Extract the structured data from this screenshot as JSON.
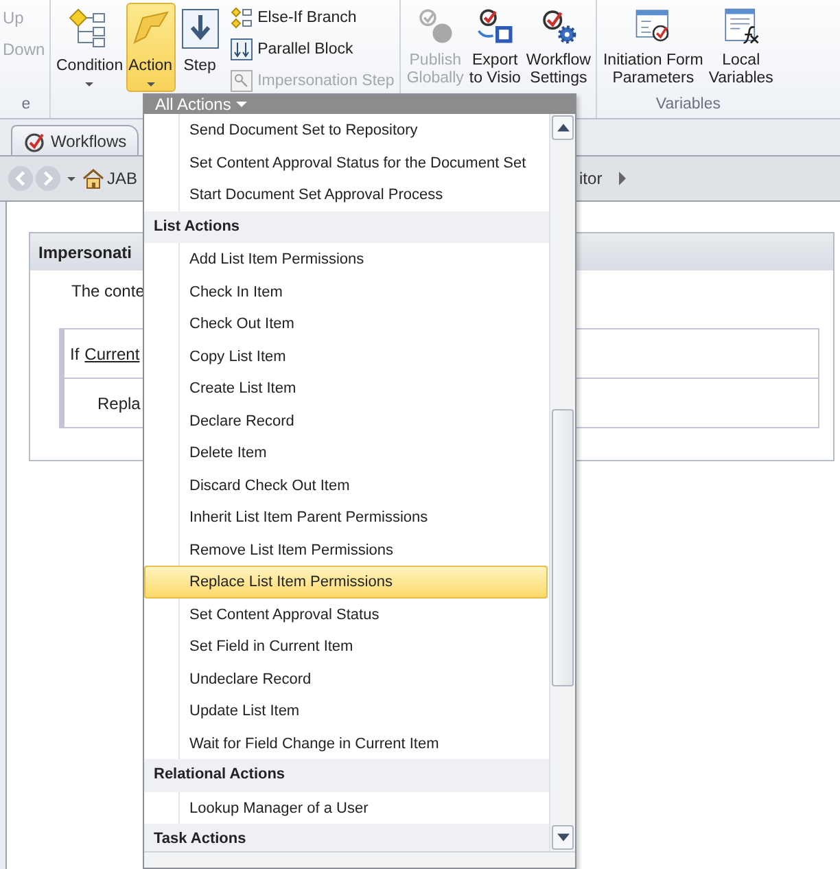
{
  "ribbon": {
    "clipped_group": {
      "buttons": [
        {
          "label": "Up",
          "disabled": true
        },
        {
          "label": "Down",
          "disabled": true
        }
      ],
      "group_label": "e"
    },
    "large_buttons": [
      {
        "label": "Condition",
        "dropdown": true,
        "selected": false
      },
      {
        "label": "Action",
        "dropdown": true,
        "selected": true
      },
      {
        "label": "Step",
        "dropdown": false,
        "selected": false
      }
    ],
    "small_buttons": [
      {
        "label": "Else-If Branch",
        "disabled": false
      },
      {
        "label": "Parallel Block",
        "disabled": false
      },
      {
        "label": "Impersonation Step",
        "disabled": true
      }
    ],
    "manage_buttons": [
      {
        "lines": [
          "Publish",
          "Globally"
        ],
        "disabled": true
      },
      {
        "lines": [
          "Export",
          "to Visio"
        ],
        "disabled": false
      },
      {
        "lines": [
          "Workflow",
          "Settings"
        ],
        "disabled": false
      }
    ],
    "variables_group": {
      "buttons": [
        {
          "lines": [
            "Initiation Form",
            "Parameters"
          ]
        },
        {
          "lines": [
            "Local",
            "Variables"
          ]
        }
      ],
      "label": "Variables"
    }
  },
  "tabs": [
    {
      "label": "Workflows",
      "selected": true
    }
  ],
  "breadcrumb": {
    "start": "JAB",
    "end": "itor"
  },
  "panel": {
    "title": "Impersonati",
    "description": "The conte",
    "condition": {
      "keyword": "If",
      "link": "Current"
    },
    "action": "Repla"
  },
  "menu": {
    "title": "All Actions",
    "rows": [
      {
        "kind": "item",
        "label": "Send Document Set to Repository",
        "selected": false
      },
      {
        "kind": "item",
        "label": "Set Content Approval Status for the Document Set",
        "selected": false
      },
      {
        "kind": "item",
        "label": "Start Document Set Approval Process",
        "selected": false
      },
      {
        "kind": "header",
        "label": "List Actions"
      },
      {
        "kind": "item",
        "label": "Add List Item Permissions",
        "selected": false
      },
      {
        "kind": "item",
        "label": "Check In Item",
        "selected": false
      },
      {
        "kind": "item",
        "label": "Check Out Item",
        "selected": false
      },
      {
        "kind": "item",
        "label": "Copy List Item",
        "selected": false
      },
      {
        "kind": "item",
        "label": "Create List Item",
        "selected": false
      },
      {
        "kind": "item",
        "label": "Declare Record",
        "selected": false
      },
      {
        "kind": "item",
        "label": "Delete Item",
        "selected": false
      },
      {
        "kind": "item",
        "label": "Discard Check Out Item",
        "selected": false
      },
      {
        "kind": "item",
        "label": "Inherit List Item Parent Permissions",
        "selected": false
      },
      {
        "kind": "item",
        "label": "Remove List Item Permissions",
        "selected": false
      },
      {
        "kind": "item",
        "label": "Replace List Item Permissions",
        "selected": true
      },
      {
        "kind": "item",
        "label": "Set Content Approval Status",
        "selected": false
      },
      {
        "kind": "item",
        "label": "Set Field in Current Item",
        "selected": false
      },
      {
        "kind": "item",
        "label": "Undeclare Record",
        "selected": false
      },
      {
        "kind": "item",
        "label": "Update List Item",
        "selected": false
      },
      {
        "kind": "item",
        "label": "Wait for Field Change in Current Item",
        "selected": false
      },
      {
        "kind": "header",
        "label": "Relational Actions"
      },
      {
        "kind": "item",
        "label": "Lookup Manager of a User",
        "selected": false
      },
      {
        "kind": "header",
        "label": "Task Actions"
      }
    ]
  }
}
